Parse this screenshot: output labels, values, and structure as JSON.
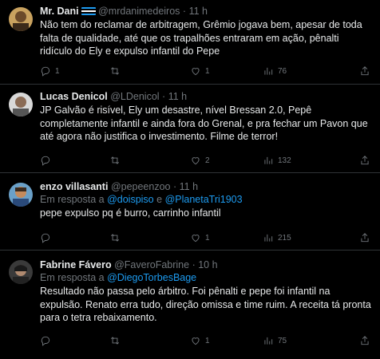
{
  "tweets": [
    {
      "name": "Mr. Dani",
      "handle": "@mrdanimedeiros",
      "time": "11 h",
      "reply_label": "",
      "mentions": [],
      "text": "Não tem do reclamar de arbitragem, Grêmio jogava bem, apesar de toda falta de qualidade, até que os trapalhões entraram em ação, pênalti ridículo do Ely e expulso infantil do Pepe",
      "replies": "1",
      "retweets": "",
      "likes": "1",
      "views": "76"
    },
    {
      "name": "Lucas Denicol",
      "handle": "@LDenicol",
      "time": "11 h",
      "reply_label": "",
      "mentions": [],
      "text": "JP Galvão é risível, Ely um desastre, nível Bressan 2.0,  Pepê completamente infantil e ainda fora do Grenal, e pra fechar um Pavon que até agora não justifica o investimento. Filme de terror!",
      "replies": "",
      "retweets": "",
      "likes": "2",
      "views": "132"
    },
    {
      "name": "enzo villasanti",
      "handle": "@pepeenzoo",
      "time": "11 h",
      "reply_label": "Em resposta a",
      "mentions": [
        "@doispiso",
        "@PlanetaTri1903"
      ],
      "conj": "e",
      "text": "pepe expulso pq é burro, carrinho infantil",
      "replies": "",
      "retweets": "",
      "likes": "1",
      "views": "215"
    },
    {
      "name": "Fabrine Fávero",
      "handle": "@FaveroFabrine",
      "time": "10 h",
      "reply_label": "Em resposta a",
      "mentions": [
        "@DiegoTorbesBage"
      ],
      "text": "Resultado não passa pelo árbitro. Foi pênalti e pepe foi infantil na expulsão. Renato erra tudo, direção omissa e time ruim. A receita tá pronta para o tetra rebaixamento.",
      "replies": "",
      "retweets": "",
      "likes": "1",
      "views": "75"
    }
  ],
  "separator": "·",
  "icons": [
    "reply-icon",
    "retweet-icon",
    "like-icon",
    "views-icon",
    "share-icon"
  ],
  "colors": {
    "background": "#000000",
    "text": "#e7e9ea",
    "muted": "#71767b",
    "link": "#1d9bf0",
    "divider": "#2f3336"
  }
}
